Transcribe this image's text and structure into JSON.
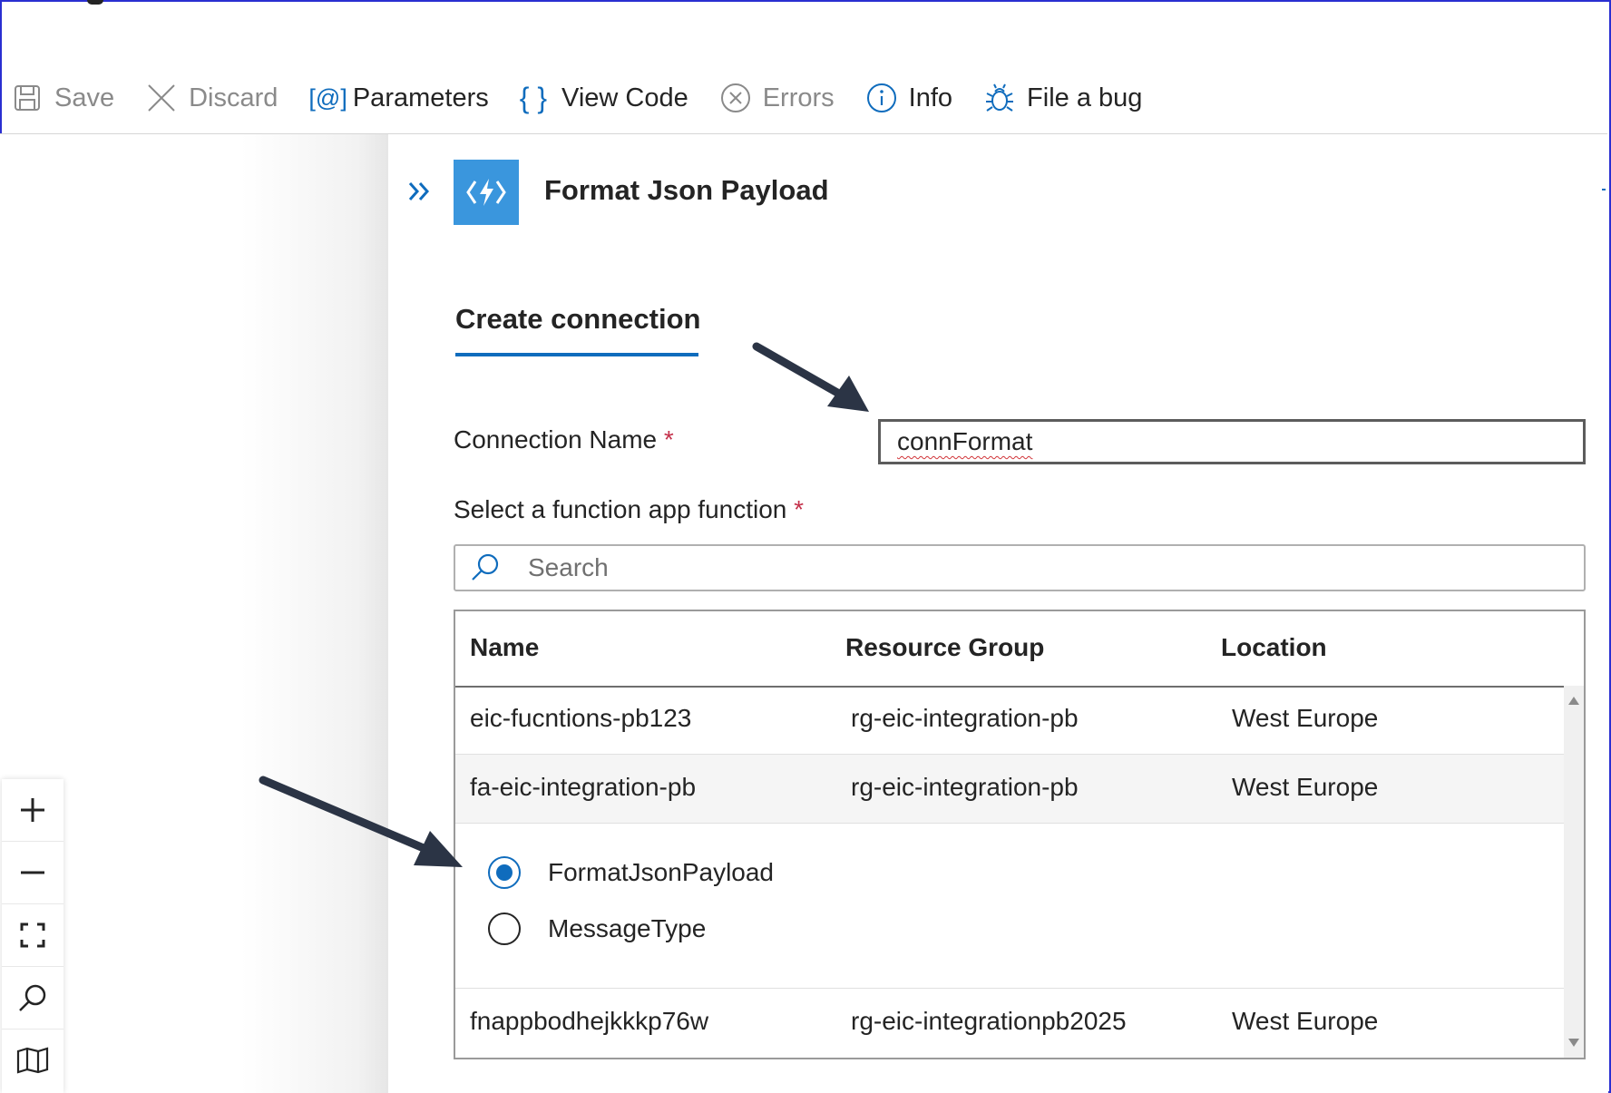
{
  "toolbar": {
    "save": "Save",
    "discard": "Discard",
    "parameters": "Parameters",
    "view_code": "View Code",
    "errors": "Errors",
    "info": "Info",
    "file_bug": "File a bug"
  },
  "panel": {
    "title": "Format Json Payload",
    "tab": "Create connection"
  },
  "form": {
    "connection_name_label": "Connection Name",
    "required_mark": "*",
    "connection_name_value": "connFormat",
    "function_label": "Select a function app function",
    "search_placeholder": "Search"
  },
  "grid": {
    "columns": [
      "Name",
      "Resource Group",
      "Location"
    ],
    "rows": [
      {
        "name": "eic-fucntions-pb123",
        "resource_group": "rg-eic-integration-pb",
        "location": "West Europe"
      },
      {
        "name": "fa-eic-integration-pb",
        "resource_group": "rg-eic-integration-pb",
        "location": "West Europe"
      },
      {
        "name": "fnappbodhejkkkp76w",
        "resource_group": "rg-eic-integrationpb2025",
        "location": "West Europe"
      }
    ],
    "functions": [
      {
        "label": "FormatJsonPayload",
        "selected": true
      },
      {
        "label": "MessageType",
        "selected": false
      }
    ]
  },
  "colors": {
    "accent": "#0f6cbd",
    "app_icon": "#3a96dd",
    "required": "#c4314b",
    "annotation_arrow": "#2b3445"
  }
}
